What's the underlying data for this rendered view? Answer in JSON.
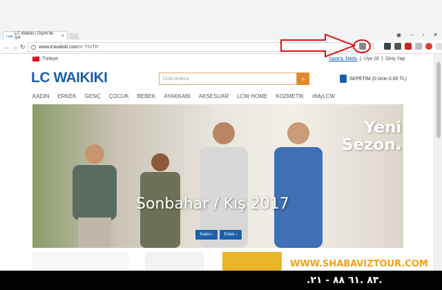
{
  "browser": {
    "tab_title": "LC Waikiki | Giyim'de Şık",
    "tab_favicon": "LCW",
    "url_domain": "www.lcwaikiki.com",
    "url_path": "/tr-TR/TR"
  },
  "site": {
    "country": "Türkiye",
    "links": [
      "Sipariş Takibi",
      "Üye Ol",
      "Giriş Yap"
    ],
    "logo": "LC WAIKIKI",
    "search_placeholder": "Ürün Arama",
    "cart_label": "SEPETİM (0 ürün 0,00 TL)",
    "menu": [
      "KADIN",
      "ERKEK",
      "GENÇ",
      "ÇOCUK",
      "BEBEK",
      "AYAKKABI",
      "AKSESUAR",
      "LCW HOME",
      "KOZMETİK",
      "#MyLCW"
    ]
  },
  "banner": {
    "badge_line1": "Yeni",
    "badge_line2": "Sezon.",
    "headline": "Sonbahar / Kış 2017",
    "buttons": [
      "Kadın ›",
      "Erkek ›"
    ]
  },
  "footer": {
    "website": "WWW.SHABAVIZTOUR.COM",
    "phone": ".۲۱ - ۸۸ ٦۱. ۸۳."
  },
  "colors": {
    "brand": "#1a60a8",
    "accent": "#e08a2c",
    "annotation": "#d11"
  }
}
